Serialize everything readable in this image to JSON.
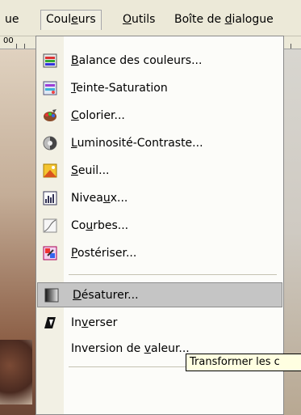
{
  "menubar": {
    "items": [
      {
        "label": "ue"
      },
      {
        "label": "Couleurs"
      },
      {
        "label": "Outils"
      },
      {
        "label": "Boîte de dialogue"
      }
    ]
  },
  "ruler": {
    "mark": "00"
  },
  "menu": {
    "items": [
      {
        "label": "Balance des couleurs...",
        "icon": "color-balance-icon"
      },
      {
        "label": "Teinte-Saturation",
        "icon": "hue-saturation-icon"
      },
      {
        "label": "Colorier...",
        "icon": "colorize-icon"
      },
      {
        "label": "Luminosité-Contraste...",
        "icon": "brightness-contrast-icon"
      },
      {
        "label": "Seuil...",
        "icon": "threshold-icon"
      },
      {
        "label": "Niveaux...",
        "icon": "levels-icon"
      },
      {
        "label": "Courbes...",
        "icon": "curves-icon"
      },
      {
        "label": "Postériser...",
        "icon": "posterize-icon"
      },
      {
        "label": "Désaturer...",
        "icon": "desaturate-icon"
      },
      {
        "label": "Inverser",
        "icon": "invert-icon"
      },
      {
        "label": "Inversion de valeur...",
        "icon": ""
      }
    ]
  },
  "tooltip": {
    "text": "Transformer les c"
  },
  "colors": {
    "highlight": "#c5c5c5",
    "menu_bg": "#fcfcf9",
    "tooltip_bg": "#ffffe1"
  }
}
